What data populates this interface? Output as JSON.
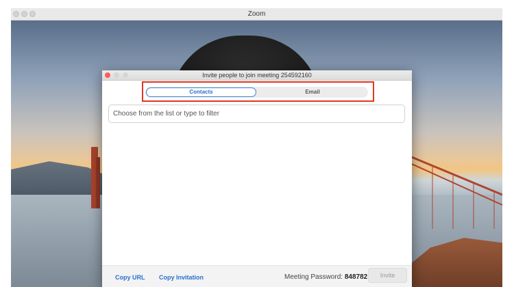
{
  "app": {
    "window_title": "Zoom"
  },
  "dialog": {
    "title": "Invite people to join meeting 254592160",
    "tabs": [
      {
        "label": "Contacts",
        "selected": true
      },
      {
        "label": "Email",
        "selected": false
      }
    ],
    "filter": {
      "placeholder": "Choose from the list or type to filter",
      "value": ""
    },
    "footer": {
      "copy_url": "Copy URL",
      "copy_invitation": "Copy Invitation",
      "password_label": "Meeting Password:",
      "password_value": "848782",
      "invite_label": "Invite"
    }
  },
  "colors": {
    "accent": "#2c6cc9",
    "highlight": "#e0361f",
    "close": "#fc5f57"
  }
}
